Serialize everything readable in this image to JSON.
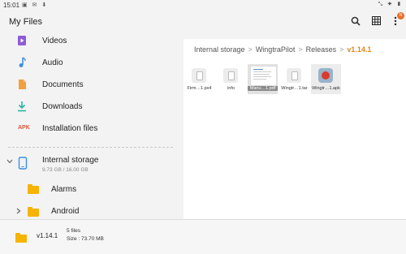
{
  "status_bar": {
    "time": "15:01",
    "left_icons": "▣ ✉ ⬇",
    "right_icons": "⤡ ✦ ▮"
  },
  "app": {
    "title": "My Files",
    "badge": "N"
  },
  "sidebar": {
    "categories": [
      {
        "label": "Videos",
        "icon": "video-icon",
        "color": "#8e5bd6"
      },
      {
        "label": "Audio",
        "icon": "music-note-icon",
        "color": "#3d8ee0"
      },
      {
        "label": "Documents",
        "icon": "document-icon",
        "color": "#f0a040"
      },
      {
        "label": "Downloads",
        "icon": "download-icon",
        "color": "#2bb3a6"
      },
      {
        "label": "Installation files",
        "icon": "apk-icon",
        "color": "#e0553a",
        "text": "APK"
      }
    ],
    "storage": {
      "label": "Internal storage",
      "usage": "9.73 GB / 16.00 GB"
    },
    "folders": [
      {
        "label": "Alarms"
      },
      {
        "label": "Android"
      }
    ]
  },
  "breadcrumb": {
    "items": [
      "Internal storage",
      "WingtraPilot",
      "Releases"
    ],
    "current": "v1.14.1",
    "separator": ">"
  },
  "files": [
    {
      "name": "Firm…1.px4",
      "type": "generic"
    },
    {
      "name": "info",
      "type": "generic"
    },
    {
      "name": "Manu…1.pdf",
      "type": "pdf",
      "selected": true
    },
    {
      "name": "Wingtr…1.tar",
      "type": "generic"
    },
    {
      "name": "Wingtr…1.apk",
      "type": "apk"
    }
  ],
  "bottom_bar": {
    "folder_name": "v1.14.1",
    "file_count": "5 files",
    "size": "Size : 73.70 MB"
  },
  "colors": {
    "accent": "#e0891a",
    "folder": "#f6b400",
    "badge": "#e8702a"
  }
}
